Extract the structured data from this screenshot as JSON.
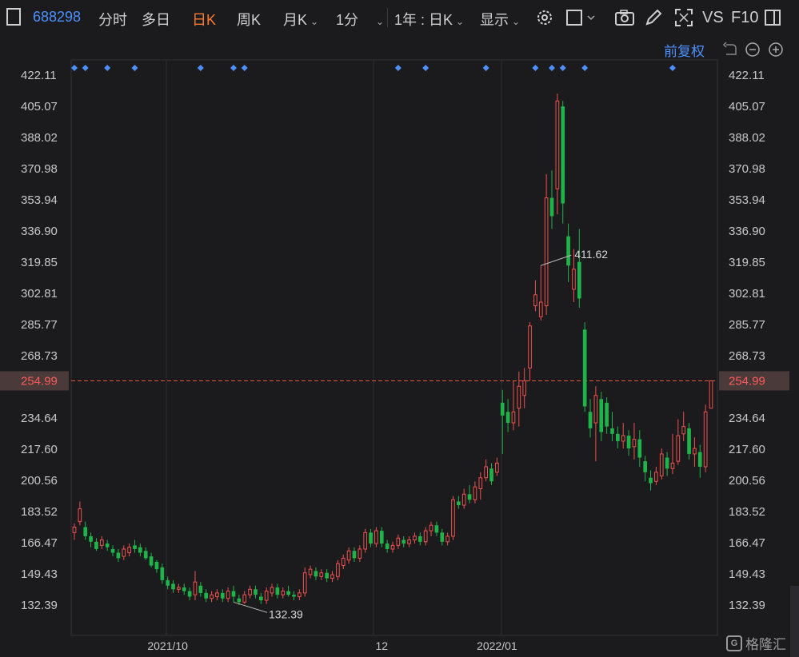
{
  "toolbar": {
    "code": "688298",
    "tabs": [
      "分时",
      "多日",
      "日K",
      "周K"
    ],
    "active_tab": "日K",
    "month_k": "月K",
    "minute": "1分",
    "range": "1年 : 日K",
    "display": "显示",
    "vs": "VS",
    "f10": "F10"
  },
  "adjust_label": "前复权",
  "colors": {
    "up": "#f0504f",
    "down": "#1fb44a",
    "grid": "#2e2e30",
    "current_line": "#e05a3a",
    "current_bg": "#4a3a3a",
    "current_text": "#ff5b5b",
    "marker": "#4e90ff",
    "accent": "#ff7a2f"
  },
  "chart_data": {
    "type": "candlestick",
    "y_ticks": [
      "422.11",
      "405.07",
      "388.02",
      "370.98",
      "353.94",
      "336.90",
      "319.85",
      "302.81",
      "285.77",
      "268.73",
      "234.64",
      "217.60",
      "200.56",
      "183.52",
      "166.47",
      "149.43",
      "132.39"
    ],
    "ylim": [
      132.39,
      422.11
    ],
    "current_price": "254.99",
    "x_labels": [
      "2021/10",
      "12",
      "2022/01"
    ],
    "x_label_index": [
      17,
      56,
      77
    ],
    "max_annotation": {
      "label": "411.62",
      "index": 85
    },
    "min_annotation": {
      "label": "132.39",
      "index": 29
    },
    "marker_indices": [
      0,
      2,
      6,
      11,
      23,
      29,
      31,
      59,
      64,
      75,
      84,
      87,
      89,
      93,
      109
    ],
    "candles": [
      [
        172,
        175,
        168,
        177,
        "u"
      ],
      [
        178,
        185,
        176,
        189,
        "u"
      ],
      [
        175,
        170,
        168,
        178,
        "d"
      ],
      [
        170,
        167,
        164,
        172,
        "d"
      ],
      [
        167,
        163,
        162,
        169,
        "d"
      ],
      [
        165,
        168,
        163,
        170,
        "u"
      ],
      [
        166,
        164,
        162,
        168,
        "d"
      ],
      [
        163,
        161,
        159,
        165,
        "d"
      ],
      [
        161,
        158,
        156,
        163,
        "d"
      ],
      [
        159,
        163,
        157,
        165,
        "u"
      ],
      [
        161,
        164,
        159,
        166,
        "u"
      ],
      [
        165,
        163,
        161,
        168,
        "d"
      ],
      [
        164,
        161,
        159,
        166,
        "d"
      ],
      [
        162,
        158,
        157,
        164,
        "d"
      ],
      [
        159,
        154,
        153,
        161,
        "d"
      ],
      [
        156,
        152,
        150,
        157,
        "d"
      ],
      [
        153,
        146,
        144,
        155,
        "d"
      ],
      [
        146,
        143,
        141,
        148,
        "d"
      ],
      [
        144,
        141,
        139,
        146,
        "d"
      ],
      [
        141,
        142,
        139,
        144,
        "u"
      ],
      [
        142,
        140,
        138,
        144,
        "d"
      ],
      [
        140,
        137,
        135,
        142,
        "d"
      ],
      [
        138,
        145,
        135,
        151,
        "u"
      ],
      [
        143,
        139,
        137,
        145,
        "d"
      ],
      [
        139,
        136,
        134,
        141,
        "d"
      ],
      [
        136,
        138,
        134,
        140,
        "u"
      ],
      [
        137,
        139,
        135,
        141,
        "u"
      ],
      [
        139,
        136,
        134,
        141,
        "d"
      ],
      [
        136,
        140,
        134,
        142,
        "u"
      ],
      [
        140,
        137,
        134,
        143,
        "d"
      ],
      [
        136,
        134,
        132.4,
        138,
        "d"
      ],
      [
        134,
        138,
        133,
        140,
        "u"
      ],
      [
        138,
        141,
        136,
        143,
        "u"
      ],
      [
        141,
        138,
        136,
        143,
        "d"
      ],
      [
        137,
        135,
        133,
        139,
        "d"
      ],
      [
        135,
        140,
        133,
        142,
        "u"
      ],
      [
        139,
        142,
        137,
        144,
        "u"
      ],
      [
        142,
        138,
        136,
        144,
        "d"
      ],
      [
        138,
        140,
        136,
        142,
        "u"
      ],
      [
        140,
        138,
        137,
        143,
        "d"
      ],
      [
        138,
        137,
        135,
        140,
        "d"
      ],
      [
        137,
        139,
        135,
        141,
        "u"
      ],
      [
        139,
        150,
        137,
        153,
        "u"
      ],
      [
        149,
        152,
        147,
        154,
        "u"
      ],
      [
        151,
        148,
        146,
        153,
        "d"
      ],
      [
        148,
        150,
        146,
        152,
        "u"
      ],
      [
        150,
        147,
        145,
        152,
        "d"
      ],
      [
        147,
        149,
        145,
        151,
        "u"
      ],
      [
        148,
        155,
        146,
        157,
        "u"
      ],
      [
        154,
        158,
        152,
        160,
        "u"
      ],
      [
        157,
        162,
        155,
        164,
        "u"
      ],
      [
        162,
        158,
        156,
        164,
        "d"
      ],
      [
        158,
        163,
        156,
        165,
        "u"
      ],
      [
        163,
        172,
        161,
        174,
        "u"
      ],
      [
        172,
        166,
        164,
        174,
        "d"
      ],
      [
        166,
        173,
        164,
        175,
        "u"
      ],
      [
        173,
        166,
        164,
        175,
        "d"
      ],
      [
        166,
        163,
        161,
        168,
        "d"
      ],
      [
        163,
        165,
        161,
        167,
        "u"
      ],
      [
        165,
        169,
        163,
        171,
        "u"
      ],
      [
        168,
        166,
        164,
        170,
        "d"
      ],
      [
        166,
        168,
        164,
        170,
        "u"
      ],
      [
        168,
        170,
        166,
        172,
        "u"
      ],
      [
        170,
        167,
        165,
        172,
        "d"
      ],
      [
        167,
        173,
        165,
        175,
        "u"
      ],
      [
        173,
        176,
        170,
        178,
        "u"
      ],
      [
        176,
        172,
        170,
        178,
        "d"
      ],
      [
        172,
        167,
        165,
        174,
        "d"
      ],
      [
        167,
        170,
        165,
        172,
        "u"
      ],
      [
        170,
        190,
        168,
        192,
        "u"
      ],
      [
        189,
        187,
        185,
        192,
        "d"
      ],
      [
        187,
        193,
        185,
        196,
        "u"
      ],
      [
        193,
        190,
        188,
        198,
        "d"
      ],
      [
        190,
        197,
        188,
        200,
        "u"
      ],
      [
        196,
        202,
        190,
        205,
        "u"
      ],
      [
        202,
        208,
        200,
        212,
        "u"
      ],
      [
        207,
        200,
        198,
        210,
        "d"
      ],
      [
        205,
        210,
        203,
        213,
        "u"
      ],
      [
        243,
        236,
        215,
        250,
        "d"
      ],
      [
        238,
        232,
        227,
        245,
        "d"
      ],
      [
        232,
        238,
        228,
        255,
        "u"
      ],
      [
        240,
        252,
        230,
        260,
        "u"
      ],
      [
        247,
        255,
        240,
        262,
        "u"
      ],
      [
        262,
        285,
        255,
        287,
        "u"
      ],
      [
        296,
        302,
        293,
        310,
        "u"
      ],
      [
        290,
        298,
        288,
        318,
        "u"
      ],
      [
        296,
        355,
        291,
        368,
        "u"
      ],
      [
        355,
        345,
        338,
        370,
        "d"
      ],
      [
        360,
        408,
        346,
        412,
        "u"
      ],
      [
        405,
        352,
        341,
        408,
        "d"
      ],
      [
        334,
        318,
        309,
        341,
        "d"
      ],
      [
        305,
        316,
        298,
        327,
        "u"
      ],
      [
        320,
        300,
        295,
        338,
        "d"
      ],
      [
        283,
        241,
        238,
        287,
        "d"
      ],
      [
        238,
        229,
        224,
        245,
        "d"
      ],
      [
        232,
        247,
        211,
        252,
        "u"
      ],
      [
        245,
        227,
        222,
        249,
        "d"
      ],
      [
        243,
        230,
        226,
        246,
        "d"
      ],
      [
        229,
        226,
        222,
        238,
        "d"
      ],
      [
        226,
        222,
        218,
        230,
        "d"
      ],
      [
        222,
        225,
        218,
        232,
        "u"
      ],
      [
        225,
        218,
        214,
        228,
        "d"
      ],
      [
        219,
        223,
        212,
        232,
        "u"
      ],
      [
        223,
        213,
        208,
        228,
        "d"
      ],
      [
        211,
        205,
        200,
        214,
        "d"
      ],
      [
        202,
        199,
        195,
        206,
        "d"
      ],
      [
        200,
        205,
        198,
        208,
        "u"
      ],
      [
        203,
        215,
        201,
        218,
        "u"
      ],
      [
        213,
        207,
        203,
        216,
        "d"
      ],
      [
        207,
        210,
        204,
        226,
        "u"
      ],
      [
        211,
        225,
        209,
        234,
        "u"
      ],
      [
        226,
        230,
        222,
        238,
        "u"
      ],
      [
        229,
        215,
        212,
        232,
        "d"
      ],
      [
        215,
        218,
        208,
        224,
        "u"
      ],
      [
        216,
        208,
        202,
        220,
        "d"
      ],
      [
        208,
        238,
        205,
        242,
        "u"
      ],
      [
        240,
        255,
        240,
        255,
        "u"
      ]
    ]
  }
}
